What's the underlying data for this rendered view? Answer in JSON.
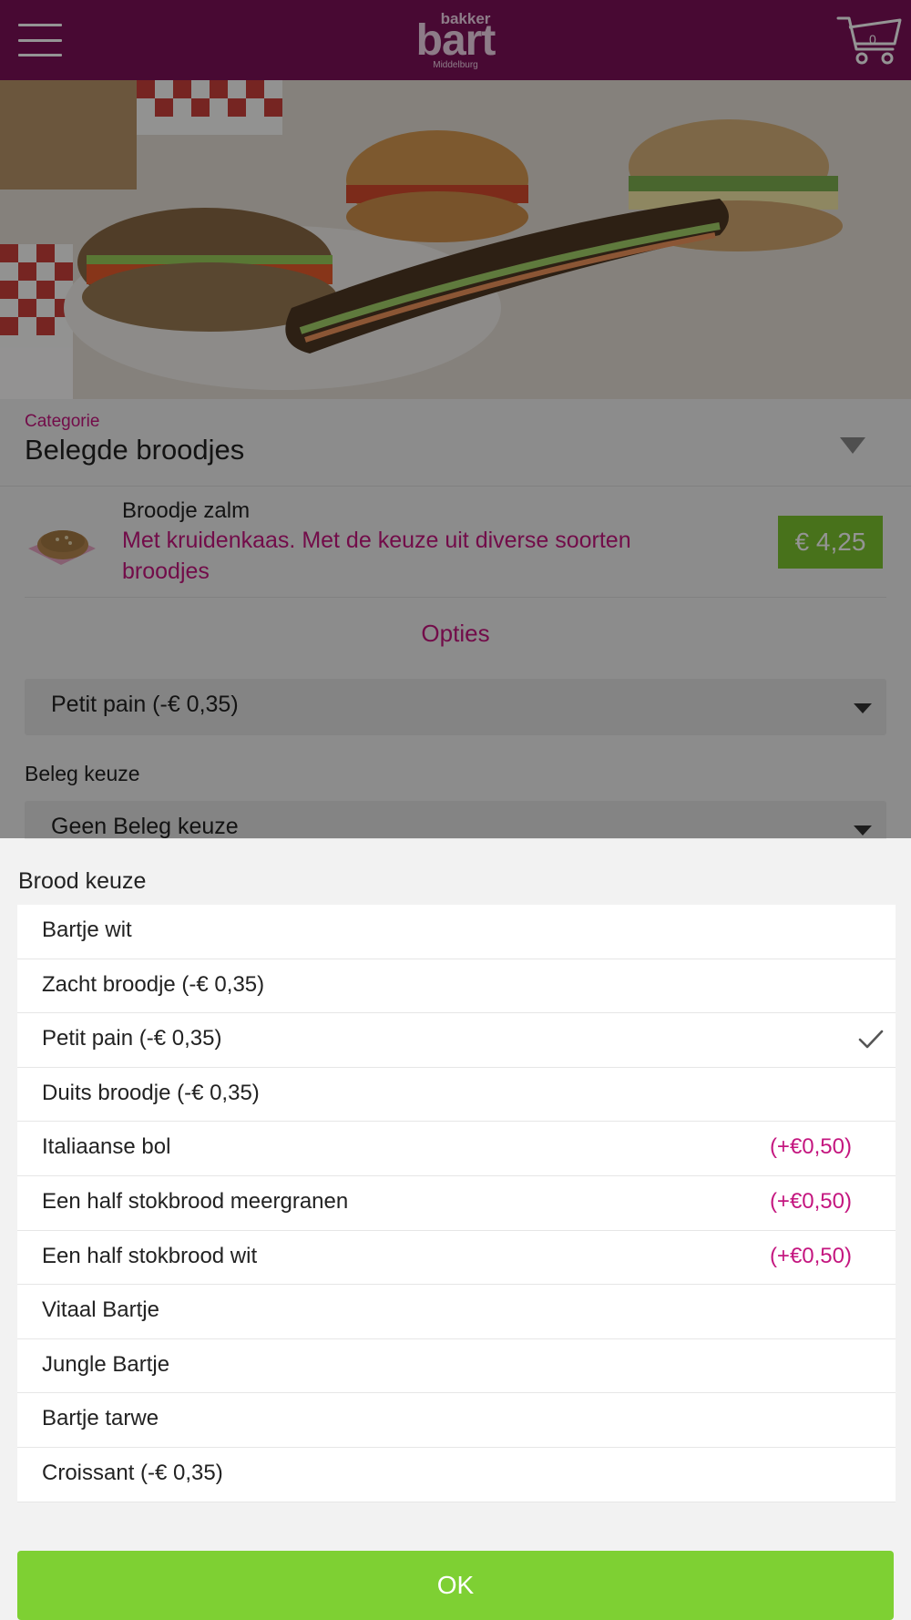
{
  "header": {
    "logo_small": "bakker",
    "logo_big": "bart",
    "logo_city": "Middelburg",
    "cart_count": "0"
  },
  "category": {
    "label": "Categorie",
    "value": "Belegde broodjes"
  },
  "product": {
    "name": "Broodje zalm",
    "description": "Met kruidenkaas. Met de keuze uit diverse soorten broodjes",
    "price": "€ 4,25"
  },
  "options_heading": "Opties",
  "bread_select": {
    "value": "Petit pain (-€ 0,35)"
  },
  "beleg": {
    "label": "Beleg keuze",
    "value": "Geen Beleg keuze"
  },
  "picker": {
    "title": "Brood keuze",
    "selected_index": 2,
    "options": [
      {
        "label": "Bartje wit",
        "extra": ""
      },
      {
        "label": "Zacht broodje (-€ 0,35)",
        "extra": ""
      },
      {
        "label": "Petit pain (-€ 0,35)",
        "extra": ""
      },
      {
        "label": "Duits broodje (-€ 0,35)",
        "extra": ""
      },
      {
        "label": "Italiaanse bol",
        "extra": "(+€0,50)"
      },
      {
        "label": "Een half stokbrood meergranen",
        "extra": "(+€0,50)"
      },
      {
        "label": "Een half stokbrood wit",
        "extra": "(+€0,50)"
      },
      {
        "label": "Vitaal Bartje",
        "extra": ""
      },
      {
        "label": "Jungle Bartje",
        "extra": ""
      },
      {
        "label": "Bartje tarwe",
        "extra": ""
      },
      {
        "label": "Croissant (-€ 0,35)",
        "extra": ""
      }
    ],
    "ok_label": "OK"
  },
  "colors": {
    "brand": "#7d1159",
    "accent": "#c4167f",
    "price_green": "#7cc42f",
    "ok_green": "#7ed033"
  },
  "icons": {
    "menu": "hamburger-menu-icon",
    "cart": "shopping-cart-icon",
    "dropdown": "triangle-down-icon",
    "selected": "checkmark-icon"
  }
}
